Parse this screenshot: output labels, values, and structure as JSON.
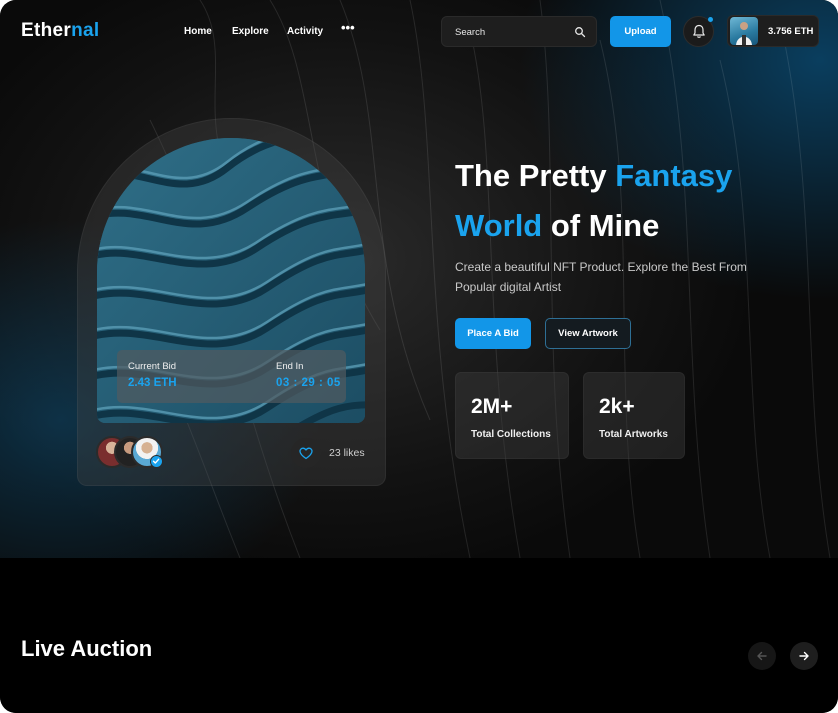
{
  "brand": {
    "logo_part1": "Ether",
    "logo_part2": "nal",
    "accent": "#1aa3ee"
  },
  "nav": {
    "items": [
      "Home",
      "Explore",
      "Activity"
    ],
    "more": "•••"
  },
  "search": {
    "placeholder": "Search",
    "icon": "search-icon"
  },
  "header": {
    "upload_label": "Upload",
    "notification_icon": "bell-icon",
    "balance": "3.756 ETH"
  },
  "hero": {
    "title_line1_a": "The Pretty ",
    "title_line1_b": "Fantasy",
    "title_line2_a": "World",
    "title_line2_b": " of Mine",
    "subtitle": "Create a beautiful NFT Product. Explore the Best From Popular digital Artist",
    "primary_button": "Place A Bid",
    "secondary_button": "View Artwork",
    "stats": [
      {
        "value": "2M+",
        "label": "Total Collections"
      },
      {
        "value": "2k+",
        "label": "Total Artworks"
      }
    ]
  },
  "card": {
    "current_bid_label": "Current Bid",
    "current_bid_value": "2.43 ETH",
    "end_label": "End In",
    "end_value": "03 : 29 : 05",
    "likes": "23 likes"
  },
  "auction": {
    "title": "Live Auction",
    "prev_icon": "arrow-left-icon",
    "next_icon": "arrow-right-icon"
  }
}
